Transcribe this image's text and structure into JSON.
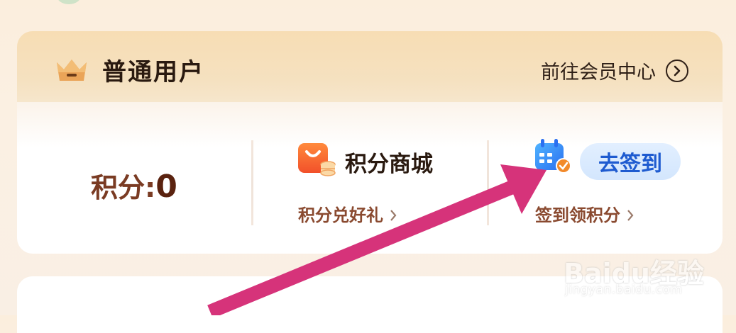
{
  "membership": {
    "level": "普通用户",
    "member_center_link": "前往会员中心"
  },
  "points": {
    "label": "积分:",
    "value": "0"
  },
  "points_mall": {
    "title": "积分商城",
    "subtitle": "积分兑好礼"
  },
  "checkin": {
    "button": "去签到",
    "subtitle": "签到领积分"
  },
  "watermark": {
    "brand": "Baidu经验",
    "url": "jingyan.baidu.com"
  },
  "colors": {
    "accent_blue": "#1e5bd0",
    "annotation_arrow": "#d6337a",
    "crown": "#e8a35a",
    "mall_icon": "#f56a2e"
  },
  "icons": [
    "crown-icon",
    "chevron-right-circle-icon",
    "shopping-bag-icon",
    "calendar-check-icon",
    "chevron-right-icon"
  ]
}
